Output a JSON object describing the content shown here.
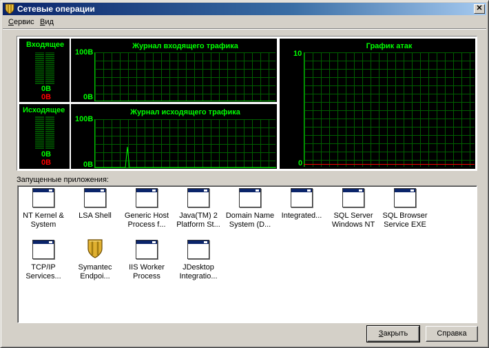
{
  "window": {
    "title": "Сетевые операции",
    "close_glyph": "✕"
  },
  "menu": [
    {
      "label": "Сервис",
      "accel": "С",
      "rest": "ервис"
    },
    {
      "label": "Вид",
      "accel": "В",
      "rest": "ид"
    }
  ],
  "monitor": {
    "incoming": {
      "label": "Входящее",
      "value_green": "0B",
      "value_red": "0B",
      "graph_title": "Журнал входящего трафика",
      "y_max": "100B",
      "y_min": "0B"
    },
    "outgoing": {
      "label": "Исходящее",
      "value_green": "0B",
      "value_red": "0B",
      "graph_title": "Журнал исходящего трафика",
      "y_max": "100B",
      "y_min": "0B"
    },
    "attacks": {
      "graph_title": "График атак",
      "y_max": "10",
      "y_min": "0"
    }
  },
  "apps": {
    "label": "Запущенные приложения:",
    "items": [
      {
        "line1": "NT Kernel &",
        "line2": "System",
        "icon": "window-icon"
      },
      {
        "line1": "LSA Shell",
        "line2": "",
        "icon": "window-icon"
      },
      {
        "line1": "Generic Host",
        "line2": "Process f...",
        "icon": "window-icon"
      },
      {
        "line1": "Java(TM) 2",
        "line2": "Platform St...",
        "icon": "window-icon"
      },
      {
        "line1": "Domain Name",
        "line2": "System (D...",
        "icon": "window-icon"
      },
      {
        "line1": "Integrated...",
        "line2": "",
        "icon": "window-icon"
      },
      {
        "line1": "SQL Server",
        "line2": "Windows NT",
        "icon": "window-icon"
      },
      {
        "line1": "SQL Browser",
        "line2": "Service EXE",
        "icon": "window-icon"
      },
      {
        "line1": "TCP/IP",
        "line2": "Services...",
        "icon": "window-icon"
      },
      {
        "line1": "Symantec",
        "line2": "Endpoi...",
        "icon": "shield-icon"
      },
      {
        "line1": "IIS Worker",
        "line2": "Process",
        "icon": "window-icon"
      },
      {
        "line1": "JDesktop",
        "line2": "Integratio...",
        "icon": "window-icon"
      }
    ]
  },
  "buttons": {
    "close": {
      "label": "Закрыть",
      "accel": "З",
      "rest": "акрыть"
    },
    "help": {
      "label": "Справка",
      "accel": "",
      "rest": "Справка"
    }
  },
  "colors": {
    "graph_green": "#00ff00",
    "alert_red": "#ff0000",
    "title_blue": "#0a246a"
  }
}
